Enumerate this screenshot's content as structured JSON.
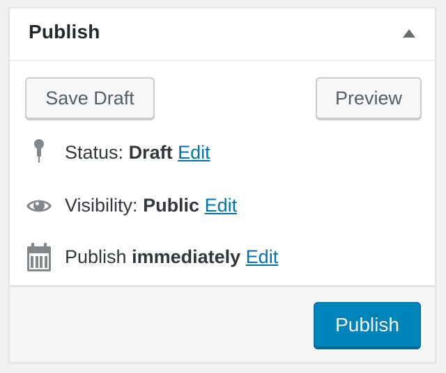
{
  "box": {
    "title": "Publish",
    "toggle_icon": "triangle-up-icon"
  },
  "actions": {
    "save_draft_label": "Save Draft",
    "preview_label": "Preview"
  },
  "status": {
    "icon": "pin-icon",
    "label": "Status:",
    "value": "Draft",
    "edit_label": "Edit"
  },
  "visibility": {
    "icon": "eye-icon",
    "label": "Visibility:",
    "value": "Public",
    "edit_label": "Edit"
  },
  "schedule": {
    "icon": "calendar-icon",
    "label": "Publish",
    "value": "immediately",
    "edit_label": "Edit"
  },
  "publish_button_label": "Publish",
  "colors": {
    "link": "#0073aa",
    "primary_button": "#0085ba",
    "icon": "#82878c"
  }
}
